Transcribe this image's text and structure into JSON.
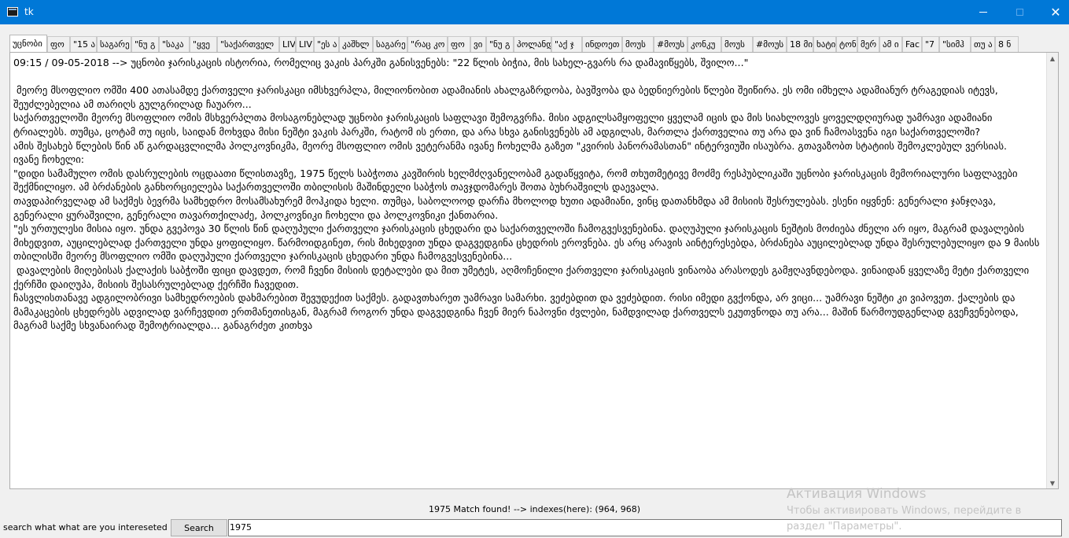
{
  "window": {
    "title": "tk",
    "minimize_glyph": "",
    "maximize_glyph": "",
    "close_glyph": "✕"
  },
  "tabs": [
    "უცნობი",
    "ფო",
    "\"15 ა",
    "საგარე",
    "\"ნუ გ",
    "\"საკა",
    "\"ყვე",
    "\"საქართველ",
    "LIV",
    "LIV",
    "\"ეს ა",
    "კაშხლ",
    "საგარე",
    "\"რაც კო",
    "ფო",
    "ვი",
    "\"ნუ გ",
    "პოლანდ",
    "\"აქ ჯ",
    "ინდოეთ",
    "მოუს",
    "#მოუს",
    "კონკუ",
    "მოუს",
    "#მოუს",
    "18 მი",
    "ხატი",
    "ტონ",
    "მერ",
    "ამ ი",
    "Fac",
    "\"7",
    "\"სიმჰ",
    "თუ ა",
    "8 ნ"
  ],
  "content": {
    "lines": [
      "09:15 / 09-05-2018 --> უცნობი ჯარისკაცის ისტორია, რომელიც ვაკის პარკში განისვენებს: \"22 წლის ბიჭია, მის სახელ-გვარს რა დამავიწყებს, შვილო...\"",
      "",
      " მეორე მსოფლიო ომში 400 ათასამდე ქართველი ჯარისკაცი იმსხვერპლა, მილიონობით ადამიანის ახალგაზრდობა, ბავშვობა და ბედნიერების წლები შეიწირა. ეს ომი იმხელა ადამიანურ ტრაგედიას იტევს, შეუძლებელია ამ თარიღს გულგრილად ჩაუარო...",
      "საქართველოში მეორე მსოფლიო ომის მსხვერპლთა მოსაგონებლად უცნობი ჯარისკაცის საფლავი შემოგვრჩა. მისი ადგილსამყოფელი ყველამ იცის და მის სიახლოვეს ყოველდღიურად უამრავი ადამიანი ტრიალებს. თუმცა, ცოტამ თუ იცის, საიდან მოხვდა მისი ნეშტი ვაკის პარკში, რატომ ის ერთი, და არა სხვა განისვენებს ამ ადგილას, მართლა ქართველია თუ არა და ვინ ჩამოასვენა იგი საქართველოში?",
      "ამის შესახებ წლების წინ აწ გარდაცვლილმა პოლკოვნიკმა, მეორე მსოფლიო ომის ვეტერანმა ივანე ჩოხელმა გაზეთ \"კვირის პანორამასთან\" ინტერვიუში ისაუბრა. გთავაზობთ სტატიის შემოკლებულ ვერსიას.",
      "ივანე ჩოხელი:",
      "\"დიდი სამამულო ომის დასრულების ოცდაათი წლისთავზე, 1975 წელს საბჭოთა კავშირის ხელმძღვანელობამ გადაწყვიტა, რომ თხუთმეტივე მოძმე რესპუბლიკაში უცნობი ჯარისკაცის მემორიალური საფლავები შექმნილიყო. ამ ბრძანების განხორციელება საქართველოში თბილისის მაშინდელი საბჭოს თავჯდომარეს შოთა ბუხრაშვილს დაევალა.",
      "თავდაპირველად ამ საქმეს ბევრმა სამხედრო მოსამსახურემ მოჰკიდა ხელი. თუმცა, საბოლოოდ დარჩა მხოლოდ ხუთი ადამიანი, ვინც დათანხმდა ამ მისიის შესრულებას. ესენი იყვნენ: გენერალი ჯანჯღავა, გენერალი ყურაშვილი, გენერალი თავართქილაძე, პოლკოვნიკი ჩოხელი და პოლკოვნიკი ქანთარია.",
      "\"ეს ურთულესი მისია იყო. უნდა გვეპოვა 30 წლის წინ დაღუპული ქართველი ჯარისკაცის ცხედარი და საქართველოში ჩამოგვესვენებინა. დაღუპული ჯარისკაცის ნეშტის მოძიება ძნელი არ იყო, მაგრამ დავალების მიხედვით, აუცილებლად ქართველი უნდა ყოფილიყო. წარმოიდგინეთ, რის მიხედვით უნდა დაგვედგინა ცხედრის ეროვნება. ეს არც არავის აინტერესებდა, ბრძანება აუცილებლად უნდა შესრულებულიყო და 9 მაისს თბილისში მეორე მსოფლიო ომში დაღუპული ქართველი ჯარისკაცის ცხედარი უნდა ჩამოგვესვენებინა...",
      " დავალების მიღებისას ქალაქის საბჭოში ფიცი დავდეთ, რომ ჩვენი მისიის დეტალები და მით უმეტეს, აღმოჩენილი ქართველი ჯარისკაცის ვინაობა არასოდეს გამჟღავნდებოდა. ვინაიდან ყველაზე მეტი ქართველი ქერჩში დაიღუპა, მისიის შესასრულებლად ქერჩში ჩავედით.",
      "ჩასვლისთანავე ადგილობრივი სამხედროების დახმარებით შევუდექით საქმეს. გადავთხარეთ უამრავი სამარხი. ვეძებდით და ვეძებდით. რისი იმედი გვქონდა, არ ვიცი... უამრავი ნეშტი კი ვიპოვეთ. ქალების და მამაკაცების ცხედრებს ადვილად ვარჩევდით ერთმანეთისგან, მაგრამ როგორ უნდა დაგვედგინა ჩვენ მიერ ნაპოვნი ძვლები, ნამდვილად ქართველს ეკუთვნოდა თუ არა... მაშინ წარმოუდგენლად გვეჩვენებოდა, მაგრამ საქმე სხვანაირად შემოტრიალდა... განაგრძეთ კითხვა"
    ]
  },
  "status": {
    "match_text": "1975 Match found! --> indexes(here):  (964, 968)"
  },
  "search": {
    "label": "search what what are you intereseted in",
    "button_label": "Search",
    "input_value": "1975"
  },
  "activation": {
    "heading": "Активация Windows",
    "line1": "Чтобы активировать Windows, перейдите в",
    "line2": "раздел \"Параметры\"."
  },
  "colors": {
    "titlebar": "#0078d7",
    "background": "#f0f0f0",
    "watermark": "#c4c4c4"
  }
}
